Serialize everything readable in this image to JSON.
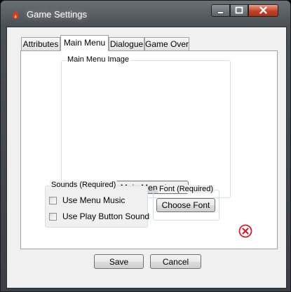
{
  "window": {
    "title": "Game Settings"
  },
  "tabs": [
    {
      "label": "Attributes"
    },
    {
      "label": "Main Menu",
      "selected": true
    },
    {
      "label": "Dialogue"
    },
    {
      "label": "Game Over"
    }
  ],
  "main_menu": {
    "image_group": {
      "legend": "Main Menu Image",
      "select_button": "Select Main Menu Image"
    }
  },
  "sounds": {
    "legend": "Sounds (Required)",
    "options": [
      {
        "label": "Use Menu Music",
        "checked": false
      },
      {
        "label": "Use Play Button Sound",
        "checked": false
      }
    ]
  },
  "font": {
    "legend": "Font (Required)",
    "choose_button": "Choose Font"
  },
  "footer": {
    "save_label": "Save",
    "cancel_label": "Cancel"
  },
  "icons": {
    "app": "flame-icon",
    "minimize": "minimize-icon",
    "maximize": "maximize-icon",
    "close": "close-icon",
    "clear_font": "clear-circle-x-icon"
  },
  "colors": {
    "clear_icon": "#cc1f2f",
    "close_button": "#c3422a"
  }
}
